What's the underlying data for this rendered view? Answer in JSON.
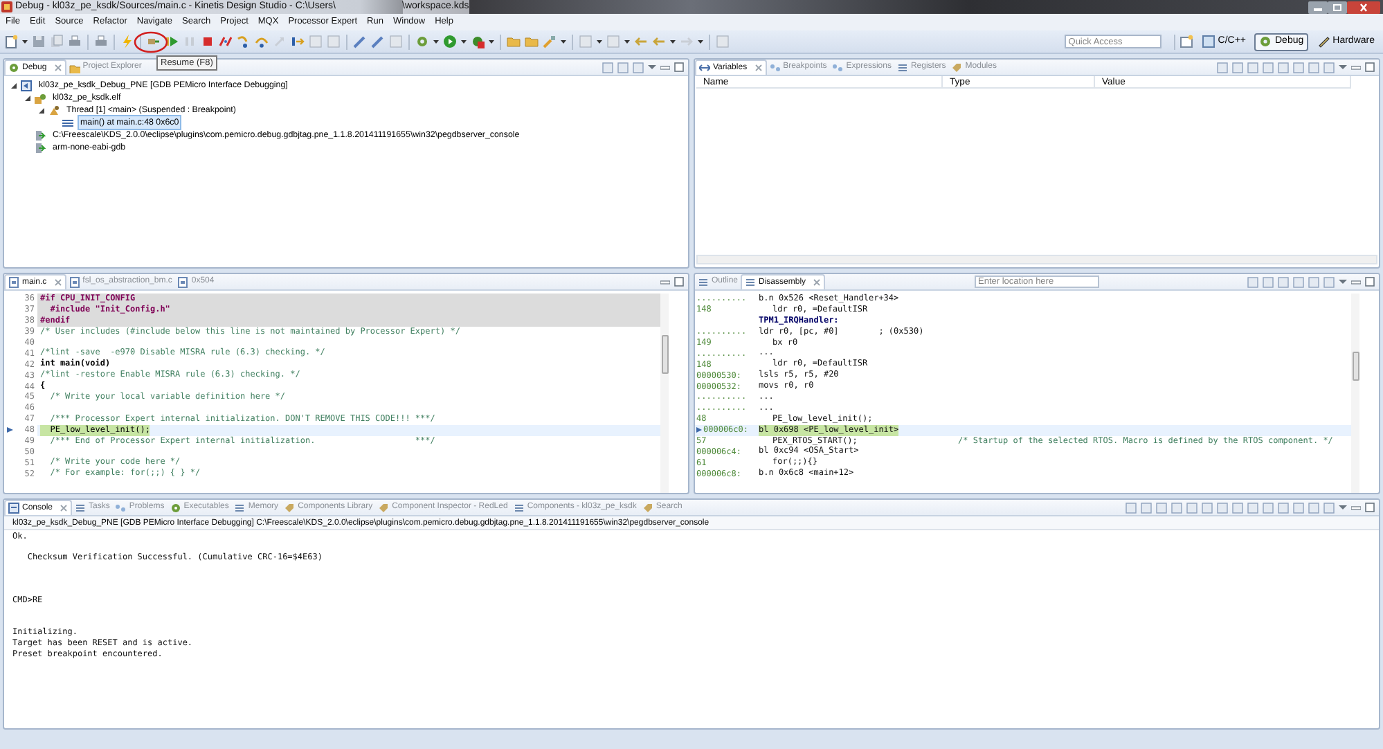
{
  "window": {
    "title": "Debug - kl03z_pe_ksdk/Sources/main.c - Kinetis Design Studio - C:\\Users\\",
    "title_end": "\\workspace.kds"
  },
  "menu": [
    "File",
    "Edit",
    "Source",
    "Refactor",
    "Navigate",
    "Search",
    "Project",
    "MQX",
    "Processor Expert",
    "Run",
    "Window",
    "Help"
  ],
  "tooltip": "Resume (F8)",
  "quick_access": {
    "placeholder": "Quick Access"
  },
  "perspectives": [
    {
      "label": "C/C++",
      "selected": false
    },
    {
      "label": "Debug",
      "selected": true
    },
    {
      "label": "Hardware",
      "selected": false
    }
  ],
  "debug_view": {
    "tabs": [
      {
        "label": "Debug",
        "selected": true
      },
      {
        "label": "Project Explorer",
        "selected": false
      }
    ],
    "tree": [
      {
        "label": "kl03z_pe_ksdk_Debug_PNE [GDB PEMicro Interface Debugging]",
        "expanded": true,
        "selected": false,
        "children": [
          {
            "label": "kl03z_pe_ksdk.elf",
            "expanded": true,
            "selected": false,
            "children": [
              {
                "label": "Thread [1] <main> (Suspended : Breakpoint)",
                "expanded": true,
                "selected": false,
                "children": [
                  {
                    "label": "main() at main.c:48 0x6c0",
                    "selected": true
                  }
                ]
              }
            ]
          },
          {
            "label": "C:\\Freescale\\KDS_2.0.0\\eclipse\\plugins\\com.pemicro.debug.gdbjtag.pne_1.1.8.201411191655\\win32\\pegdbserver_console",
            "selected": false
          },
          {
            "label": "arm-none-eabi-gdb",
            "selected": false
          }
        ]
      }
    ]
  },
  "variables_view": {
    "tabs": [
      {
        "label": "Variables",
        "selected": true
      },
      {
        "label": "Breakpoints",
        "selected": false
      },
      {
        "label": "Expressions",
        "selected": false
      },
      {
        "label": "Registers",
        "selected": false
      },
      {
        "label": "Modules",
        "selected": false
      }
    ],
    "columns": [
      "Name",
      "Type",
      "Value"
    ]
  },
  "editor": {
    "tabs": [
      {
        "label": "main.c",
        "selected": true
      },
      {
        "label": "fsl_os_abstraction_bm.c",
        "selected": false
      },
      {
        "label": "0x504",
        "selected": false
      }
    ],
    "lines": [
      {
        "number": "36",
        "kind": "inactive",
        "text": "#if CPU_INIT_CONFIG"
      },
      {
        "number": "37",
        "kind": "inactive",
        "text": "  #include \"Init_Config.h\""
      },
      {
        "number": "38",
        "kind": "inactive",
        "text": "#endif"
      },
      {
        "number": "39",
        "kind": "comment",
        "text": "/* User includes (#include below this line is not maintained by Processor Expert) */"
      },
      {
        "number": "40",
        "kind": "blank"
      },
      {
        "number": "41",
        "kind": "comment",
        "text": "/*lint -save  -e970 Disable MISRA rule (6.3) checking. */"
      },
      {
        "number": "42",
        "kind": "code",
        "text": "int main(void)"
      },
      {
        "number": "43",
        "kind": "comment",
        "text": "/*lint -restore Enable MISRA rule (6.3) checking. */"
      },
      {
        "number": "44",
        "kind": "code",
        "text": "{"
      },
      {
        "number": "45",
        "kind": "comment",
        "text": "  /* Write your local variable definition here */"
      },
      {
        "number": "46",
        "kind": "blank"
      },
      {
        "number": "47",
        "kind": "comment",
        "text": "  /*** Processor Expert internal initialization. DON'T REMOVE THIS CODE!!! ***/"
      },
      {
        "number": "48",
        "kind": "current",
        "text": "  PE_low_level_init();"
      },
      {
        "number": "49",
        "kind": "comment",
        "text": "  /*** End of Processor Expert internal initialization.                    ***/"
      },
      {
        "number": "50",
        "kind": "blank"
      },
      {
        "number": "51",
        "kind": "comment",
        "text": "  /* Write your code here */"
      },
      {
        "number": "52",
        "kind": "comment",
        "text": "  /* For example: for(;;) { } */"
      }
    ]
  },
  "disassembly_view": {
    "tabs": [
      {
        "label": "Outline",
        "selected": false
      },
      {
        "label": "Disassembly",
        "selected": true
      }
    ],
    "location": {
      "placeholder": "Enter location here"
    },
    "lines": [
      {
        "address": "..........",
        "kind": "instruction",
        "text": "b.n 0x526 <Reset_Handler+34>"
      },
      {
        "address": "148",
        "kind": "source",
        "text": "ldr r0, =DefaultISR"
      },
      {
        "kind": "label",
        "text": "TPM1_IRQHandler:"
      },
      {
        "address": "..........",
        "kind": "instruction",
        "text": "ldr r0, [pc, #0]        ; (0x530)"
      },
      {
        "address": "149",
        "kind": "source",
        "text": "bx r0"
      },
      {
        "address": "..........",
        "kind": "instruction",
        "text": "..."
      },
      {
        "address": "148",
        "kind": "source",
        "text": "ldr r0, =DefaultISR"
      },
      {
        "address": "00000530:",
        "kind": "instruction",
        "text": "lsls r5, r5, #20"
      },
      {
        "address": "00000532:",
        "kind": "instruction",
        "text": "movs r0, r0"
      },
      {
        "address": "..........",
        "kind": "instruction",
        "text": "..."
      },
      {
        "address": "..........",
        "kind": "instruction",
        "text": "..."
      },
      {
        "address": "48",
        "kind": "source",
        "text": "PE_low_level_init();"
      },
      {
        "address": "000006c0:",
        "kind": "current",
        "text": "bl 0x698 <PE_low_level_init>"
      },
      {
        "address": "57",
        "kind": "source",
        "text": "PEX_RTOS_START();",
        "comment": "/* Startup of the selected RTOS. Macro is defined by the RTOS component. */"
      },
      {
        "address": "000006c4:",
        "kind": "instruction",
        "text": "bl 0xc94 <OSA_Start>"
      },
      {
        "address": "61",
        "kind": "source",
        "text": "for(;;){}"
      },
      {
        "address": "000006c8:",
        "kind": "instruction",
        "text": "b.n 0x6c8 <main+12>"
      }
    ]
  },
  "console_view": {
    "tabs": [
      {
        "label": "Console",
        "selected": true
      },
      {
        "label": "Tasks",
        "selected": false
      },
      {
        "label": "Problems",
        "selected": false
      },
      {
        "label": "Executables",
        "selected": false
      },
      {
        "label": "Memory",
        "selected": false
      },
      {
        "label": "Components Library",
        "selected": false
      },
      {
        "label": "Component Inspector - RedLed",
        "selected": false
      },
      {
        "label": "Components - kl03z_pe_ksdk",
        "selected": false
      },
      {
        "label": "Search",
        "selected": false
      }
    ],
    "process": "kl03z_pe_ksdk_Debug_PNE [GDB PEMicro Interface Debugging] C:\\Freescale\\KDS_2.0.0\\eclipse\\plugins\\com.pemicro.debug.gdbjtag.pne_1.1.8.201411191655\\win32\\pegdbserver_console",
    "lines": [
      {
        "kind": "text",
        "text": "Ok."
      },
      {
        "kind": "blank"
      },
      {
        "kind": "text",
        "text": "   Checksum Verification Successful. (Cumulative CRC-16=$4E63)"
      },
      {
        "kind": "blank"
      },
      {
        "kind": "blank"
      },
      {
        "kind": "blank"
      },
      {
        "kind": "text",
        "text": "CMD>RE"
      },
      {
        "kind": "blank"
      },
      {
        "kind": "blank"
      },
      {
        "kind": "text",
        "text": "Initializing."
      },
      {
        "kind": "text",
        "text": "Target has been RESET and is active."
      },
      {
        "kind": "text",
        "text": "Preset breakpoint encountered."
      }
    ]
  }
}
